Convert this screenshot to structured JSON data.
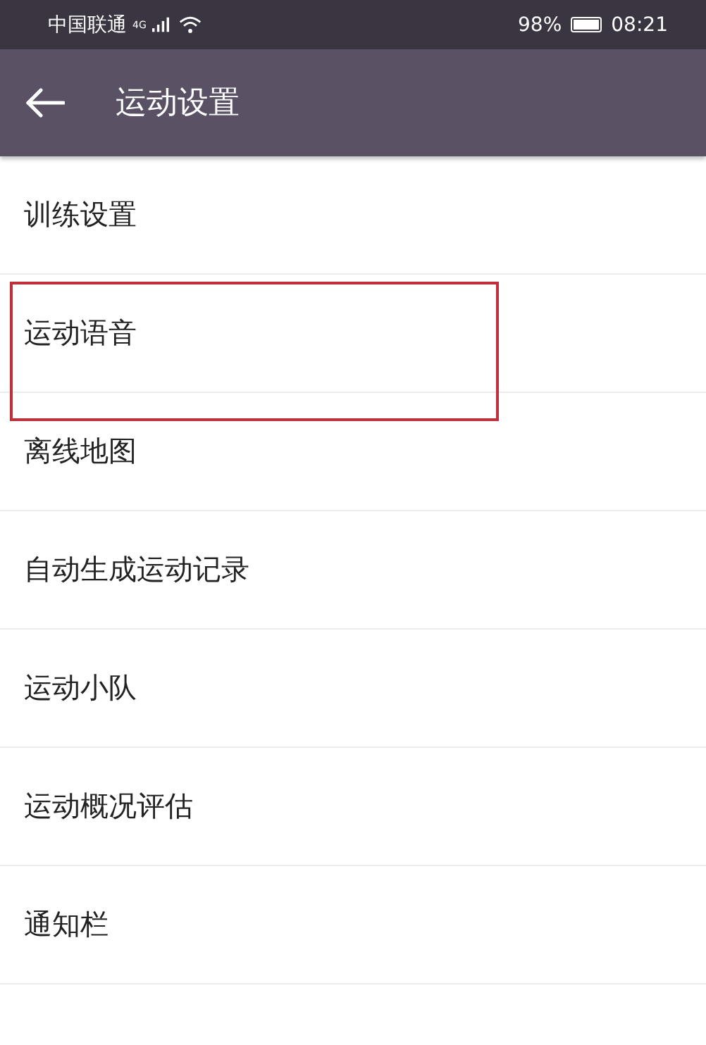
{
  "status_bar": {
    "carrier": "中国联通",
    "network": "4G",
    "battery": "98%",
    "time": "08:21"
  },
  "header": {
    "title": "运动设置"
  },
  "items": [
    {
      "label": "训练设置",
      "highlighted": false
    },
    {
      "label": "运动语音",
      "highlighted": true
    },
    {
      "label": "离线地图",
      "highlighted": false
    },
    {
      "label": "自动生成运动记录",
      "highlighted": false
    },
    {
      "label": "运动小队",
      "highlighted": false
    },
    {
      "label": "运动概况评估",
      "highlighted": false
    },
    {
      "label": "通知栏",
      "highlighted": false
    }
  ]
}
